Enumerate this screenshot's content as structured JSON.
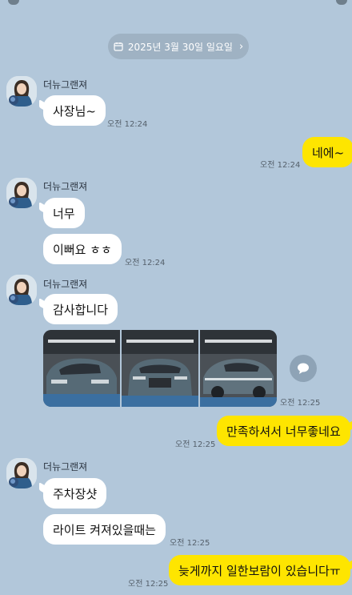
{
  "date_divider": {
    "label": "2025년 3월 30일 일요일"
  },
  "messages": [
    {
      "sender": "더뉴그랜져",
      "text": "사장님~",
      "time": "오전 12:24"
    },
    {
      "text": "네에~",
      "time": "오전 12:24"
    },
    {
      "sender": "더뉴그랜져",
      "text": "너무"
    },
    {
      "text": "이뻐요 ㅎㅎ",
      "time": "오전 12:24"
    },
    {
      "sender": "더뉴그랜져",
      "text": "감사합니다"
    },
    {
      "photo_time": "오전 12:25"
    },
    {
      "text": "만족하셔서 너무좋네요",
      "time": "오전 12:25"
    },
    {
      "sender": "더뉴그랜져",
      "text": "주차장샷"
    },
    {
      "text": "라이트 켜져있을때는",
      "time": "오전 12:25"
    },
    {
      "text": "늦게까지 일한보람이 있습니다ㅠ",
      "time": "오전 12:25"
    }
  ],
  "icons": {
    "calendar": "calendar-icon",
    "chevron": "chevron-right-icon",
    "share": "share-bubble-icon"
  },
  "colors": {
    "background": "#b2c7da",
    "incoming_bubble": "#ffffff",
    "outgoing_bubble": "#fee500",
    "date_pill": "#9fb2c3"
  }
}
